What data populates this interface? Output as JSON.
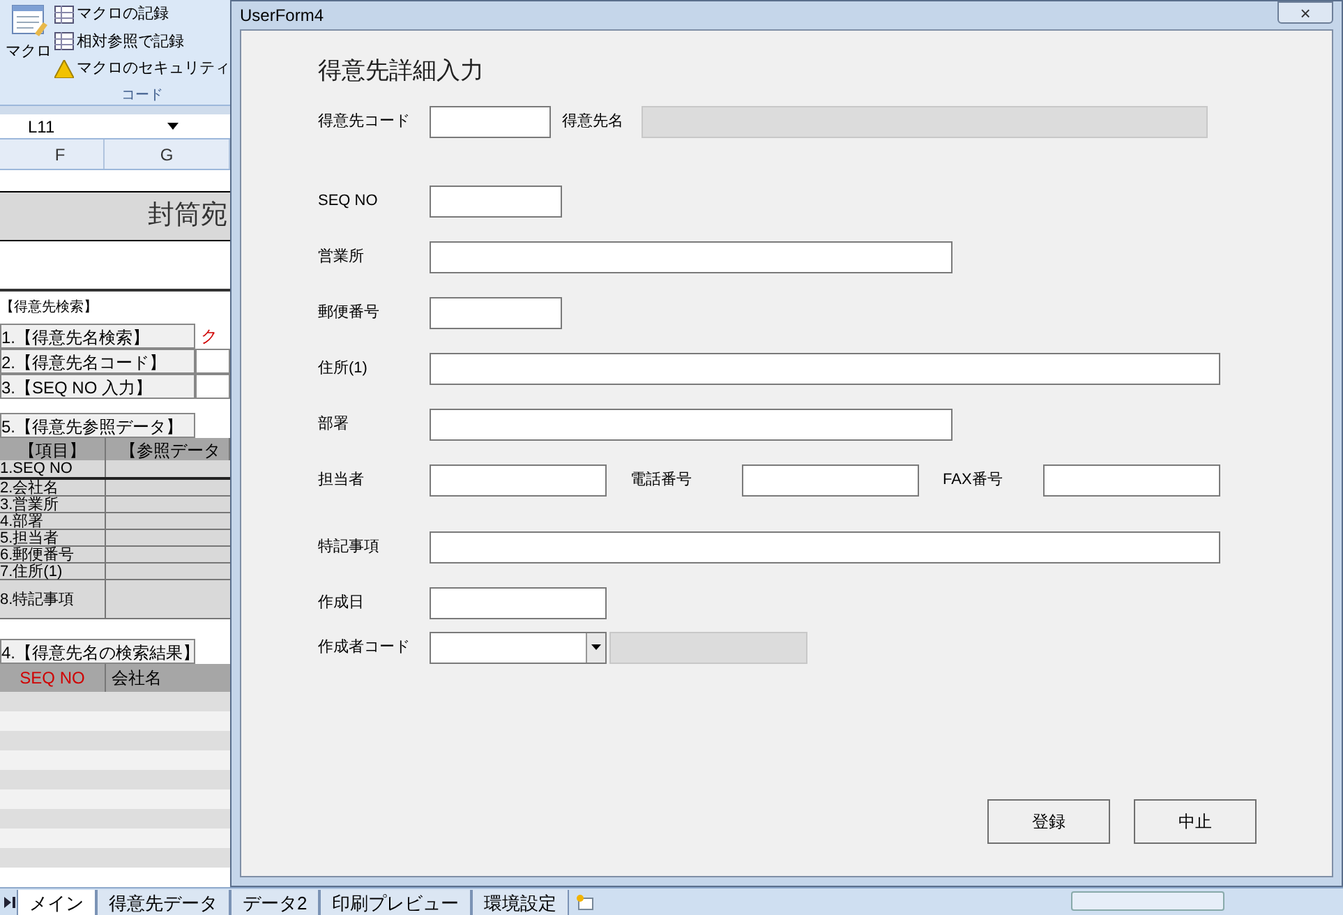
{
  "ribbon": {
    "macro_button": "マクロ",
    "items": [
      "マクロの記録",
      "相対参照で記録",
      "マクロのセキュリティ"
    ],
    "group": "コード"
  },
  "name_box": "L11",
  "columns": [
    "F",
    "G"
  ],
  "sheet": {
    "title": "封筒宛",
    "search_group": "【得意先検索】",
    "search_buttons": [
      "1.【得意先名検索】",
      "2.【得意先名コード】",
      "3.【SEQ NO 入力】"
    ],
    "clear_text": "ク",
    "ref_button": "5.【得意先参照データ】",
    "ref_headers": [
      "【項目】",
      "【参照データ"
    ],
    "ref_rows": [
      "1.SEQ NO",
      "2.会社名",
      "3.営業所",
      "4.部署",
      "5.担当者",
      "6.郵便番号",
      "7.住所(1)",
      "8.特記事項"
    ],
    "result_button": "4.【得意先名の検索結果】",
    "result_headers": [
      "SEQ NO",
      "会社名"
    ]
  },
  "sheet_tabs": [
    {
      "label": "メイン",
      "selected": true
    },
    {
      "label": "得意先データ",
      "selected": false
    },
    {
      "label": "データ2",
      "selected": false
    },
    {
      "label": "印刷プレビュー",
      "selected": false
    },
    {
      "label": "環境設定",
      "selected": false
    }
  ],
  "form": {
    "title": "UserForm4",
    "close": "×",
    "heading": "得意先詳細入力",
    "fields": [
      {
        "label": "得意先コード"
      },
      {
        "label": "得意先名"
      },
      {
        "label": "SEQ NO"
      },
      {
        "label": "営業所"
      },
      {
        "label": "郵便番号"
      },
      {
        "label": "住所(1)"
      },
      {
        "label": "部署"
      },
      {
        "label": "担当者"
      },
      {
        "label": "電話番号"
      },
      {
        "label": "FAX番号"
      },
      {
        "label": "特記事項"
      },
      {
        "label": "作成日"
      },
      {
        "label": "作成者コード"
      }
    ],
    "buttons": [
      "登録",
      "中止"
    ]
  }
}
